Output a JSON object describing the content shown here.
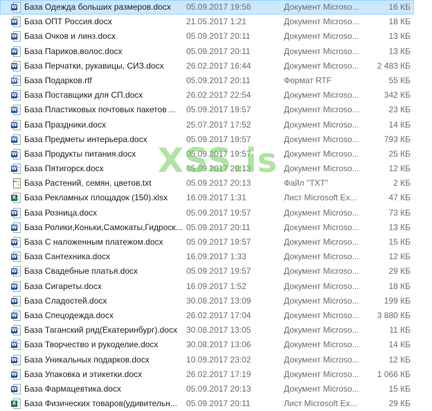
{
  "file_list": {
    "rows": [
      {
        "name": "База Одежда больших размеров.docx",
        "date": "05.09.2017 19:56",
        "type": "Документ Microso...",
        "size": "16 КБ",
        "icon": "word-document-icon",
        "selected": true
      },
      {
        "name": "База ОПТ Россия.docx",
        "date": "21.05.2017 1:21",
        "type": "Документ Microso...",
        "size": "18 КБ",
        "icon": "word-document-icon"
      },
      {
        "name": "База Очков и линз.docx",
        "date": "05.09.2017 20:11",
        "type": "Документ Microso...",
        "size": "13 КБ",
        "icon": "word-document-icon"
      },
      {
        "name": "База Париков,волос.docx",
        "date": "05.09.2017 20:11",
        "type": "Документ Microso...",
        "size": "13 КБ",
        "icon": "word-document-icon"
      },
      {
        "name": "База Перчатки, рукавицы, СИЗ.docx",
        "date": "26.02.2017 16:44",
        "type": "Документ Microso...",
        "size": "2 483 КБ",
        "icon": "word-document-icon"
      },
      {
        "name": "База Подарков.rtf",
        "date": "05.09.2017 20:11",
        "type": "Формат RTF",
        "size": "55 КБ",
        "icon": "rtf-document-icon"
      },
      {
        "name": "База Поставщики для СП.docx",
        "date": "26.02.2017 22:54",
        "type": "Документ Microso...",
        "size": "342 КБ",
        "icon": "word-document-icon"
      },
      {
        "name": "База Пластиковых почтовых пакетов ...",
        "date": "05.09.2017 19:57",
        "type": "Документ Microso...",
        "size": "23 КБ",
        "icon": "word-document-icon"
      },
      {
        "name": "База Праздники.docx",
        "date": "25.07.2017 17:52",
        "type": "Документ Microso...",
        "size": "14 КБ",
        "icon": "word-document-icon"
      },
      {
        "name": "База Предметы интерьера.docx",
        "date": "05.09.2017 19:57",
        "type": "Документ Microso...",
        "size": "793 КБ",
        "icon": "word-document-icon"
      },
      {
        "name": "База Продукты питания.docx",
        "date": "05.09.2017 19:57",
        "type": "Документ Microso...",
        "size": "25 КБ",
        "icon": "word-document-icon"
      },
      {
        "name": "База Пятигорск.docx",
        "date": "05.09.2017 20:13",
        "type": "Документ Microso...",
        "size": "12 КБ",
        "icon": "word-document-icon"
      },
      {
        "name": "База Растений, семян, цветов.txt",
        "date": "05.09.2017 20:13",
        "type": "Файл \"TXT\"",
        "size": "2 КБ",
        "icon": "text-file-icon"
      },
      {
        "name": "База Рекламных площадок (150).xlsx",
        "date": "16.09.2017 1:31",
        "type": "Лист Microsoft Ex...",
        "size": "47 КБ",
        "icon": "excel-spreadsheet-icon"
      },
      {
        "name": "База Розница.docx",
        "date": "05.09.2017 19:57",
        "type": "Документ Microso...",
        "size": "73 КБ",
        "icon": "word-document-icon"
      },
      {
        "name": "База Ролики,Коньки,Самокаты,Гидроск...",
        "date": "05.09.2017 20:11",
        "type": "Документ Microso...",
        "size": "13 КБ",
        "icon": "word-document-icon"
      },
      {
        "name": "База С наложенным платежом.docx",
        "date": "05.09.2017 19:57",
        "type": "Документ Microso...",
        "size": "15 КБ",
        "icon": "word-document-icon"
      },
      {
        "name": "База Сантехника.docx",
        "date": "16.09.2017 1:33",
        "type": "Документ Microso...",
        "size": "12 КБ",
        "icon": "word-document-icon"
      },
      {
        "name": "База Свадебные платья.docx",
        "date": "05.09.2017 19:57",
        "type": "Документ Microso...",
        "size": "29 КБ",
        "icon": "word-document-icon"
      },
      {
        "name": "База Сигареты.docx",
        "date": "16.09.2017 1:52",
        "type": "Документ Microso...",
        "size": "18 КБ",
        "icon": "word-document-icon"
      },
      {
        "name": "База Сладостей.docx",
        "date": "30.08.2017 13:09",
        "type": "Документ Microso...",
        "size": "199 КБ",
        "icon": "word-document-icon"
      },
      {
        "name": "База Спецодежда.docx",
        "date": "26.02.2017 17:04",
        "type": "Документ Microso...",
        "size": "3 880 КБ",
        "icon": "word-document-icon"
      },
      {
        "name": "База Таганский ряд(Екатеринбург).docx",
        "date": "30.08.2017 13:05",
        "type": "Документ Microso...",
        "size": "11 КБ",
        "icon": "word-document-icon"
      },
      {
        "name": "База Творчество и рукоделие.docx",
        "date": "30.08.2017 13:06",
        "type": "Документ Microso...",
        "size": "14 КБ",
        "icon": "word-document-icon"
      },
      {
        "name": "База Уникальных подарков.docx",
        "date": "10.09.2017 23:02",
        "type": "Документ Microso...",
        "size": "12 КБ",
        "icon": "word-document-icon"
      },
      {
        "name": "База Упаковка и этикетки.docx",
        "date": "26.02.2017 17:19",
        "type": "Документ Microso...",
        "size": "1 066 КБ",
        "icon": "word-document-icon"
      },
      {
        "name": "База Фармацевтика.docx",
        "date": "05.09.2017 20:13",
        "type": "Документ Microso...",
        "size": "15 КБ",
        "icon": "word-document-icon"
      },
      {
        "name": "База Физических товаров(удивительн...",
        "date": "05.09.2017 20:11",
        "type": "Лист Microsoft Ex...",
        "size": "29 КБ",
        "icon": "excel-spreadsheet-icon"
      }
    ]
  },
  "watermark": {
    "text": "XSS.is"
  },
  "colors": {
    "selection_background": "#cce8ff",
    "selection_border": "#99d1ff",
    "word_icon": "#2b579a",
    "excel_icon": "#217346",
    "watermark": "#6ecd5a"
  }
}
